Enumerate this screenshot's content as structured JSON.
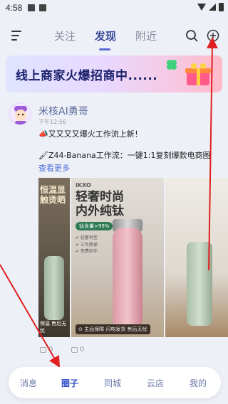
{
  "status_bar": {
    "time": "4:58"
  },
  "top_nav": {
    "tabs": [
      {
        "label": "关注",
        "active": false
      },
      {
        "label": "发现",
        "active": true
      },
      {
        "label": "附近",
        "active": false
      }
    ],
    "icons": [
      "menu-icon",
      "search-icon",
      "add-circle-icon"
    ]
  },
  "banner": {
    "text": "线上商家火爆招商中......"
  },
  "post": {
    "username": "米核AI勇哥",
    "time": "下午12:56",
    "line1": "📣又又又又爆火工作流上新！",
    "line2": "🖌Z44-Banana工作流：一键1:1复刻爆款电商图",
    "more": "查看更多",
    "images": {
      "img1_text": "恒温显\n触烫晒",
      "brand": "IKXO",
      "headline": "轻奢时尚\n内外纯钛",
      "pill": "钛含量>99%",
      "features": "✔ 轻奢有型\n✔ 三年质保\n✔ 免费刻字",
      "img1_caption": "保温  售后无忧",
      "img2_caption": "⊙ 主品保障  闪电发货  售后无忧"
    },
    "likes": "0",
    "comments": "0"
  },
  "bottom_nav": {
    "items": [
      {
        "label": "消息",
        "active": false
      },
      {
        "label": "圈子",
        "active": true
      },
      {
        "label": "同城",
        "active": false
      },
      {
        "label": "云店",
        "active": false
      },
      {
        "label": "我的",
        "active": false
      }
    ]
  },
  "colors": {
    "accent": "#3c56c9",
    "background": "#eef0f8",
    "annotation": "#e02020"
  }
}
